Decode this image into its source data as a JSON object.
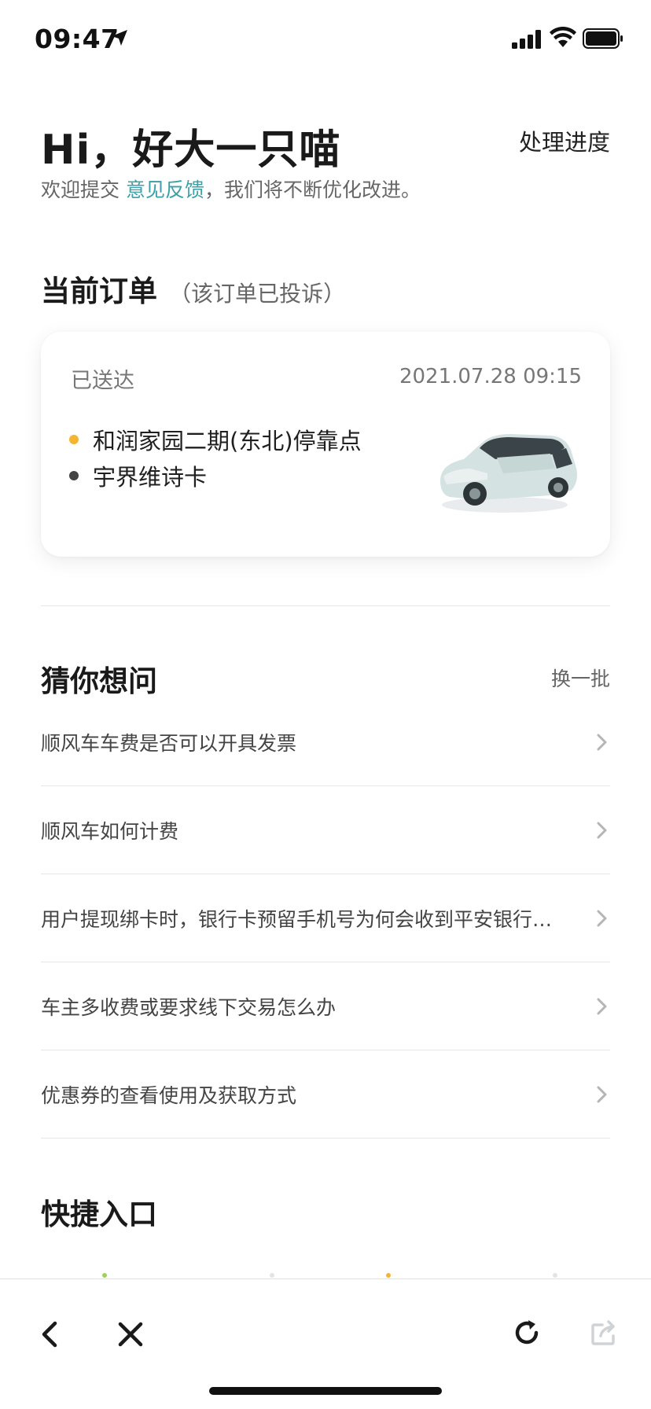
{
  "status_bar": {
    "time": "09:47"
  },
  "header": {
    "greeting": "Hi，好大一只喵",
    "progress_link": "处理进度",
    "subtitle_prefix": "欢迎提交",
    "subtitle_link": "意见反馈",
    "subtitle_suffix": "，我们将不断优化改进。"
  },
  "current_order": {
    "title": "当前订单",
    "note": "（该订单已投诉）",
    "status": "已送达",
    "datetime": "2021.07.28 09:15",
    "pickup": "和润家园二期(东北)停靠点",
    "dropoff": "宇界维诗卡"
  },
  "guess": {
    "title": "猜你想问",
    "refresh_label": "换一批",
    "items": [
      "顺风车车费是否可以开具发票",
      "顺风车如何计费",
      "用户提现绑卡时，银行卡预留手机号为何会收到平安银行…",
      "车主多收费或要求线下交易怎么办",
      "优惠券的查看使用及获取方式"
    ]
  },
  "quick_entry": {
    "title": "快捷入口"
  },
  "colors": {
    "accent": "#3ba0a8",
    "pickup_dot": "#f5b533",
    "dropoff_dot": "#444444"
  },
  "icons": {
    "bottom_nav": [
      "back-icon",
      "close-icon",
      "reload-icon",
      "share-icon"
    ]
  }
}
